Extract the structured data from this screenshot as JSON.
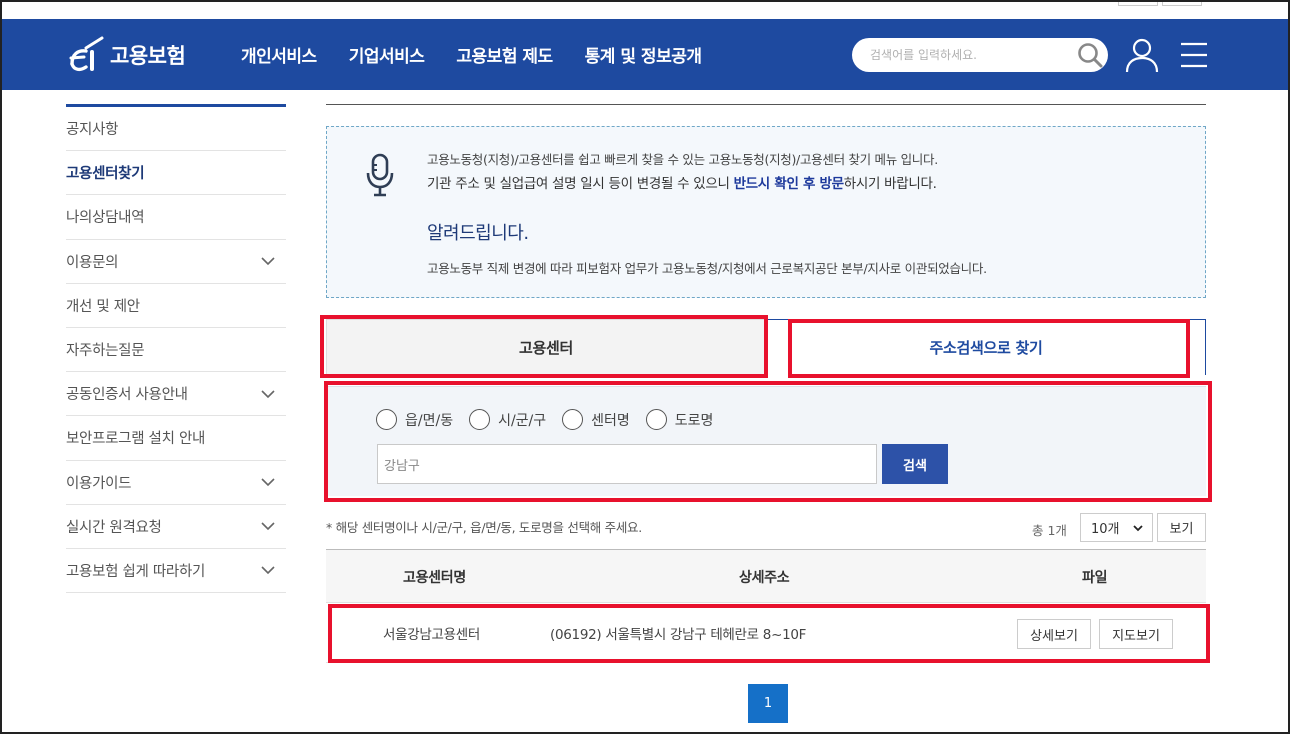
{
  "header": {
    "logo_text": "고용보험",
    "nav": [
      "개인서비스",
      "기업서비스",
      "고용보험 제도",
      "통계 및 정보공개"
    ],
    "search_placeholder": "검색어를 입력하세요."
  },
  "sidebar": {
    "items": [
      {
        "label": "공지사항",
        "active": false,
        "has_submenu": false
      },
      {
        "label": "고용센터찾기",
        "active": true,
        "has_submenu": false
      },
      {
        "label": "나의상담내역",
        "active": false,
        "has_submenu": false
      },
      {
        "label": "이용문의",
        "active": false,
        "has_submenu": true
      },
      {
        "label": "개선 및 제안",
        "active": false,
        "has_submenu": false
      },
      {
        "label": "자주하는질문",
        "active": false,
        "has_submenu": false
      },
      {
        "label": "공동인증서 사용안내",
        "active": false,
        "has_submenu": true
      },
      {
        "label": "보안프로그램 설치 안내",
        "active": false,
        "has_submenu": false
      },
      {
        "label": "이용가이드",
        "active": false,
        "has_submenu": true
      },
      {
        "label": "실시간 원격요청",
        "active": false,
        "has_submenu": true
      },
      {
        "label": "고용보험 쉽게 따라하기",
        "active": false,
        "has_submenu": true
      }
    ]
  },
  "notice": {
    "line1": "고용노동청(지청)/고용센터를 쉽고 빠르게 찾을 수 있는 고용노동청(지청)/고용센터 찾기 메뉴 입니다.",
    "line2_before": "기관 주소 및 실업급여 설명 일시 등이 변경될 수 있으니 ",
    "line2_emphasis": "반드시 확인 후 방문",
    "line2_after": "하시기 바랍니다.",
    "heading": "알려드립니다.",
    "line3": "고용노동부 직제 변경에 따라 피보험자 업무가 고용노동청/지청에서 근로복지공단 본부/지사로 이관되었습니다."
  },
  "tabs": {
    "center": "고용센터",
    "address": "주소검색으로 찾기"
  },
  "search_panel": {
    "options": [
      "읍/면/동",
      "시/군/구",
      "센터명",
      "도로명"
    ],
    "input_value": "강남구",
    "button_label": "검색"
  },
  "results": {
    "hint": "* 해당 센터명이나 시/군/구, 읍/면/동, 도로명을 선택해 주세요.",
    "total": "총 1개",
    "page_size": "10개",
    "view_button": "보기",
    "columns": [
      "고용센터명",
      "상세주소",
      "파일"
    ],
    "rows": [
      {
        "name": "서울강남고용센터",
        "address": "(06192) 서울특별시 강남구 테헤란로 8~10F",
        "detail_button": "상세보기",
        "map_button": "지도보기"
      }
    ]
  },
  "pagination": {
    "current_page": "1"
  },
  "colors": {
    "header_bg": "#1e4aa0",
    "highlight": "#e8112d",
    "primary_button": "#2d52a8",
    "pager_active": "#1570c8"
  }
}
